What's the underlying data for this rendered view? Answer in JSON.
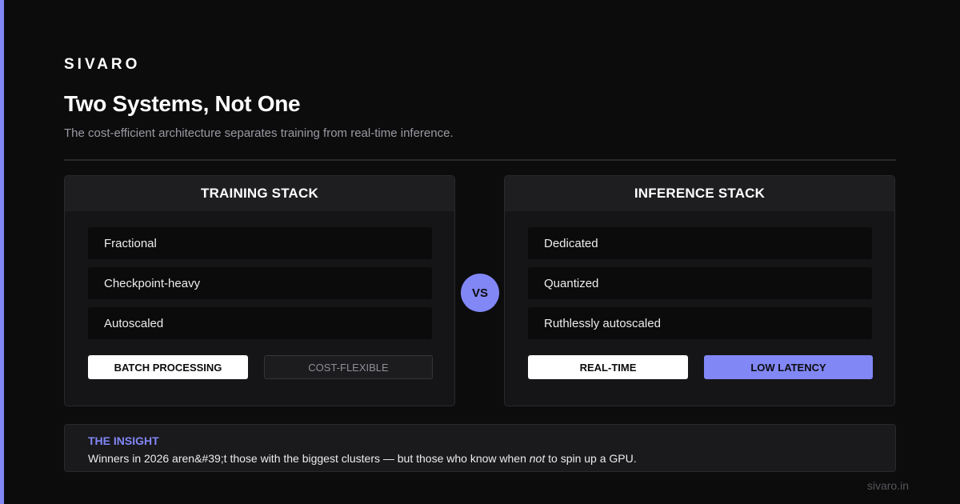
{
  "brand": "SIVARO",
  "title": "Two Systems, Not One",
  "subtitle": "The cost-efficient architecture separates training from real-time inference.",
  "colors": {
    "accent": "#8187f5",
    "background": "#0c0c0d",
    "card": "#151517"
  },
  "training": {
    "heading": "TRAINING STACK",
    "items": [
      "Fractional",
      "Checkpoint-heavy",
      "Autoscaled"
    ],
    "tags": [
      "BATCH PROCESSING",
      "COST-FLEXIBLE"
    ]
  },
  "vs_label": "VS",
  "inference": {
    "heading": "INFERENCE STACK",
    "items": [
      "Dedicated",
      "Quantized",
      "Ruthlessly autoscaled"
    ],
    "tags": [
      "REAL-TIME",
      "LOW LATENCY"
    ]
  },
  "insight": {
    "label": "THE INSIGHT",
    "text_before": "Winners in 2026 aren&#39;t those with the biggest clusters — but those who know when ",
    "text_emphasis": "not",
    "text_after": " to spin up a GPU."
  },
  "footer_url": "sivaro.in"
}
